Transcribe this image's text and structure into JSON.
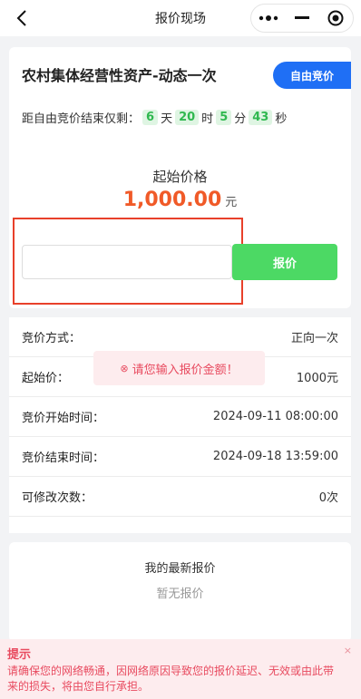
{
  "navbar": {
    "title": "报价现场",
    "back_icon": "back-arrow-icon",
    "capsule": {
      "more_icon": "more-dots-icon",
      "minimize_icon": "minimize-icon",
      "close_icon": "target-circle-icon"
    }
  },
  "asset": {
    "title": "农村集体经营性资产-动态一次",
    "free_bid_label": "自由竞价"
  },
  "countdown": {
    "prefix": "距自由竞价结束仅剩：",
    "days": "6",
    "days_unit": "天",
    "hours": "20",
    "hours_unit": "时",
    "minutes": "5",
    "minutes_unit": "分",
    "seconds": "43",
    "seconds_unit": "秒"
  },
  "start_price": {
    "label": "起始价格",
    "amount": "1,000.00",
    "unit": "元"
  },
  "bid_form": {
    "input_value": "",
    "input_placeholder": "",
    "button_label": "报价"
  },
  "info_rows": [
    {
      "label": "竞价方式：",
      "value": "正向一次"
    },
    {
      "label": "起始价：",
      "value": "1000元"
    },
    {
      "label": "竞价开始时间：",
      "value": "2024-09-11 08:00:00"
    },
    {
      "label": "竞价结束时间：",
      "value": "2024-09-18 13:59:00"
    },
    {
      "label": "可修改次数：",
      "value": "0次"
    }
  ],
  "toast": {
    "icon": "⊗",
    "message": "请您输入报价金额！"
  },
  "latest_bid": {
    "title": "我的最新报价",
    "empty_text": "暂无报价"
  },
  "notice": {
    "title": "提示",
    "text": "请确保您的网络畅通，因网络原因导致您的报价延迟、无效或由此带来的损失，将由您自行承担。",
    "close_symbol": "×"
  },
  "colors": {
    "accent_blue": "#1f6ff5",
    "bid_green": "#4cd964",
    "countdown_green": "#2fb84f",
    "price_orange": "#f05a28",
    "warning_red": "#e84a5f",
    "highlight_red": "#e8402a"
  }
}
